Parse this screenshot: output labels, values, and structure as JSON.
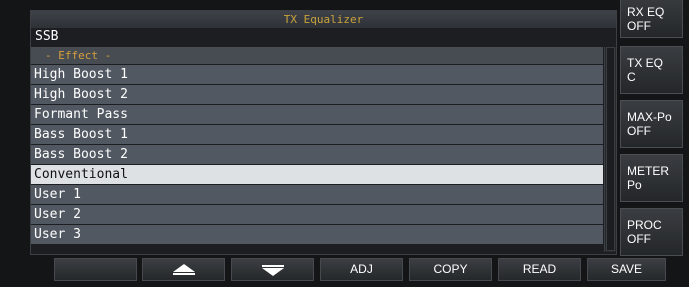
{
  "window": {
    "title": "TX Equalizer"
  },
  "mode": "SSB",
  "list": {
    "header": "- Effect -",
    "items": [
      {
        "label": "High Boost 1",
        "selected": false
      },
      {
        "label": "High Boost 2",
        "selected": false
      },
      {
        "label": "Formant Pass",
        "selected": false
      },
      {
        "label": "Bass Boost 1",
        "selected": false
      },
      {
        "label": "Bass Boost 2",
        "selected": false
      },
      {
        "label": "Conventional",
        "selected": true
      },
      {
        "label": "User 1",
        "selected": false
      },
      {
        "label": "User 2",
        "selected": false
      },
      {
        "label": "User 3",
        "selected": false
      }
    ]
  },
  "side_keys": [
    {
      "line1": "RX EQ",
      "line2": "OFF"
    },
    {
      "line1": "TX EQ",
      "line2": "C"
    },
    {
      "line1": "MAX-Po",
      "line2": "OFF"
    },
    {
      "line1": "METER",
      "line2": "Po"
    },
    {
      "line1": "PROC",
      "line2": "OFF"
    }
  ],
  "bottom_keys": {
    "blank": "",
    "up_icon": "triangle-up-icon",
    "down_icon": "triangle-down-icon",
    "adj": "ADJ",
    "copy": "COPY",
    "read": "READ",
    "save": "SAVE"
  },
  "colors": {
    "accent": "#c9a33a",
    "row_bg": "#515861",
    "row_selected_bg": "#dde1e4"
  }
}
